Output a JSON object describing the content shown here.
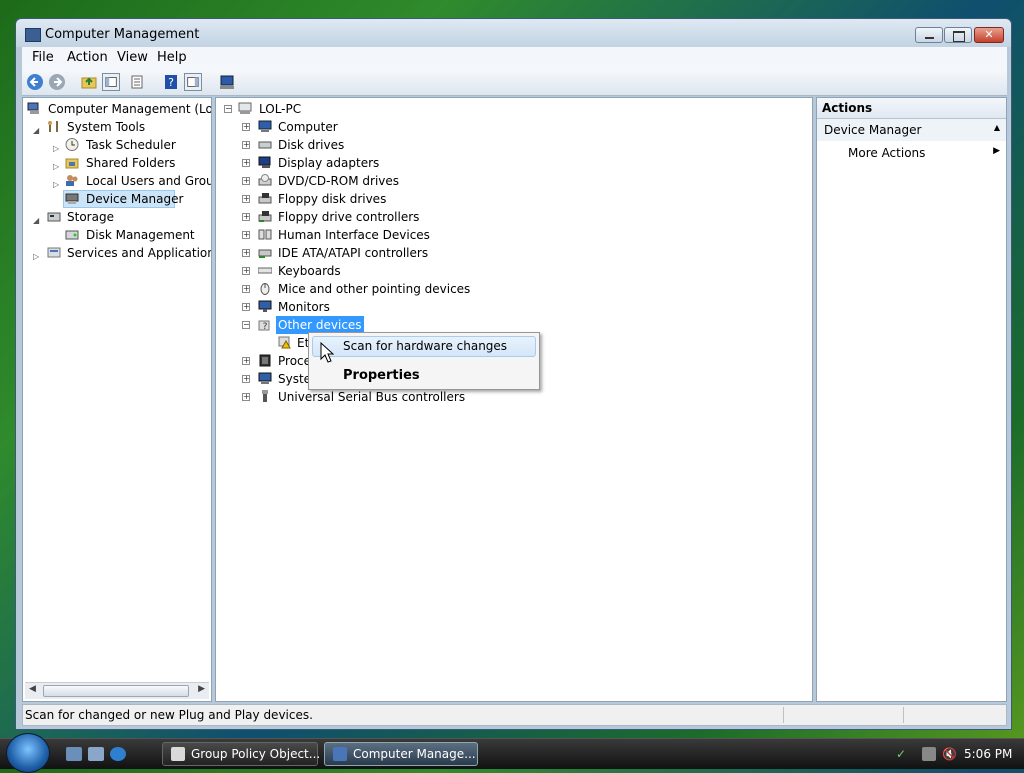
{
  "window": {
    "title": "Computer Management"
  },
  "menu": [
    "File",
    "Action",
    "View",
    "Help"
  ],
  "left_tree": [
    {
      "label": "Computer Management (Local",
      "depth": 0,
      "expander": "none",
      "icon": "computer-management-icon"
    },
    {
      "label": "System Tools",
      "depth": 1,
      "expander": "expanded",
      "icon": "tools-icon"
    },
    {
      "label": "Task Scheduler",
      "depth": 2,
      "expander": "collapsed",
      "icon": "clock-icon"
    },
    {
      "label": "Shared Folders",
      "depth": 2,
      "expander": "collapsed",
      "icon": "shared-folder-icon"
    },
    {
      "label": "Local Users and Groups",
      "depth": 2,
      "expander": "collapsed",
      "icon": "users-icon"
    },
    {
      "label": "Device Manager",
      "depth": 2,
      "expander": "none",
      "icon": "device-manager-icon",
      "selected": true
    },
    {
      "label": "Storage",
      "depth": 1,
      "expander": "expanded",
      "icon": "storage-icon"
    },
    {
      "label": "Disk Management",
      "depth": 2,
      "expander": "none",
      "icon": "disk-icon"
    },
    {
      "label": "Services and Applications",
      "depth": 1,
      "expander": "collapsed",
      "icon": "services-icon"
    }
  ],
  "device_tree": {
    "root": "LOL-PC",
    "items": [
      {
        "label": "Computer",
        "icon": "computer-icon"
      },
      {
        "label": "Disk drives",
        "icon": "disk-drive-icon"
      },
      {
        "label": "Display adapters",
        "icon": "display-adapter-icon"
      },
      {
        "label": "DVD/CD-ROM drives",
        "icon": "dvd-drive-icon"
      },
      {
        "label": "Floppy disk drives",
        "icon": "floppy-icon"
      },
      {
        "label": "Floppy drive controllers",
        "icon": "floppy-controller-icon"
      },
      {
        "label": "Human Interface Devices",
        "icon": "hid-icon"
      },
      {
        "label": "IDE ATA/ATAPI controllers",
        "icon": "ide-controller-icon"
      },
      {
        "label": "Keyboards",
        "icon": "keyboard-icon"
      },
      {
        "label": "Mice and other pointing devices",
        "icon": "mouse-icon"
      },
      {
        "label": "Monitors",
        "icon": "monitor-icon"
      },
      {
        "label": "Other devices",
        "icon": "unknown-device-icon",
        "expanded": true,
        "selected": true
      },
      {
        "label": "Et",
        "icon": "warning-device-icon",
        "child": true
      },
      {
        "label": "Proce",
        "icon": "processor-icon"
      },
      {
        "label": "Syster",
        "icon": "system-devices-icon"
      },
      {
        "label": "Universal Serial Bus controllers",
        "icon": "usb-icon"
      }
    ]
  },
  "actions": {
    "header": "Actions",
    "section": "Device Manager",
    "more": "More Actions"
  },
  "context_menu": {
    "items": [
      "Scan for hardware changes",
      "Properties"
    ]
  },
  "status": "Scan for changed or new Plug and Play devices.",
  "taskbar": {
    "tasks": [
      "Group Policy Object...",
      "Computer Manage..."
    ],
    "clock": "5:06 PM"
  }
}
